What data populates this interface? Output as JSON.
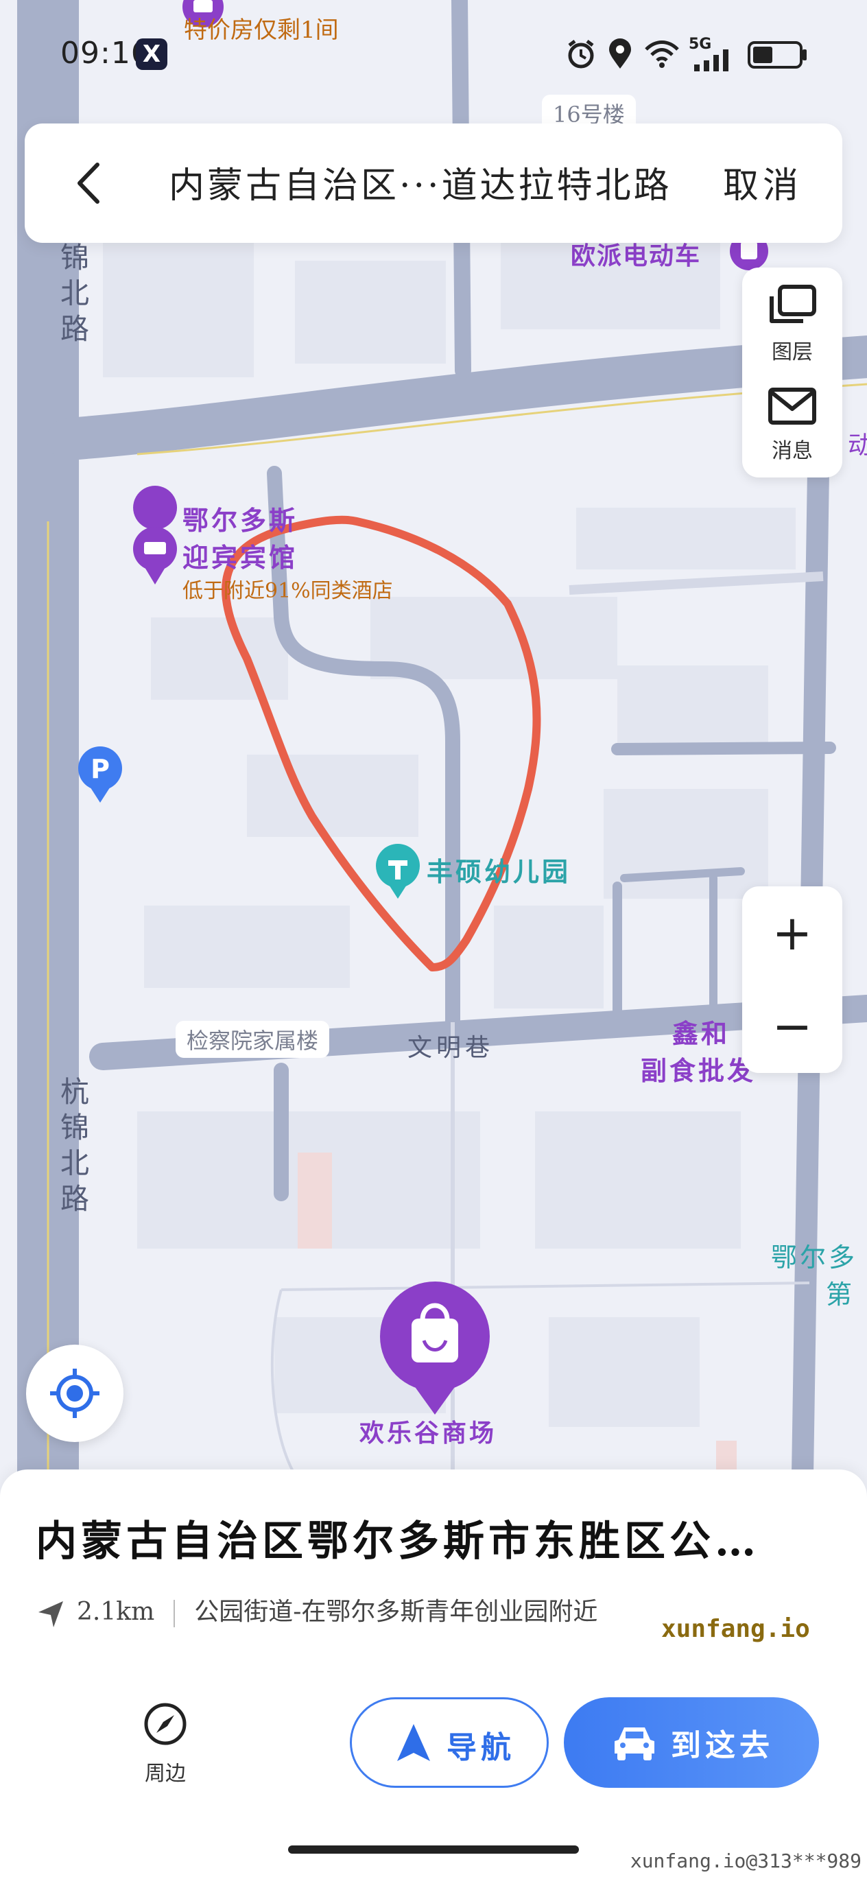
{
  "status_bar": {
    "time": "09:16",
    "app_icon_letter": "X",
    "network": "5G"
  },
  "search_bar": {
    "title": "内蒙古自治区···道达拉特北路",
    "cancel_label": "取消"
  },
  "map": {
    "roads": {
      "hangjin_north_top": "锦北路",
      "hangjin_north_bottom": "杭锦北路",
      "wenming_lane": "文明巷"
    },
    "building_tag_top": "16号楼",
    "building_tag_procuratorate": "检察院家属楼",
    "top_hotel_promo": "特价房仅剩1间",
    "hotel": {
      "name_line1": "鄂尔多斯",
      "name_line2": "迎宾宾馆",
      "promo": "低于附近91%同类酒店"
    },
    "ebike_shop": "欧派电动车",
    "kindergarten": "丰硕幼儿园",
    "wholesale": {
      "line1": "鑫和",
      "line2": "副食批发"
    },
    "mall": "欢乐谷商场",
    "edge_label_1": "鄂尔多",
    "edge_label_2": "第",
    "edge_label_3": "动"
  },
  "side_panel": {
    "layers_label": "图层",
    "messages_label": "消息"
  },
  "zoom": {
    "in_label": "+",
    "out_label": "−"
  },
  "place_sheet": {
    "address": "内蒙古自治区鄂尔多斯市东胜区公…",
    "distance": "2.1km",
    "description": "公园街道-在鄂尔多斯青年创业园附近",
    "watermark": "xunfang.io"
  },
  "bottom_bar": {
    "nearby_label": "周边",
    "navigate_label": "导航",
    "go_label": "到这去"
  },
  "footer_watermark": "xunfang.io@313***989",
  "colors": {
    "accent": "#3f7cf0",
    "poi_purple": "#8b3fc8",
    "annotation_red": "#e8604a",
    "road": "#a7b0c9",
    "map_bg": "#eef0f7"
  }
}
